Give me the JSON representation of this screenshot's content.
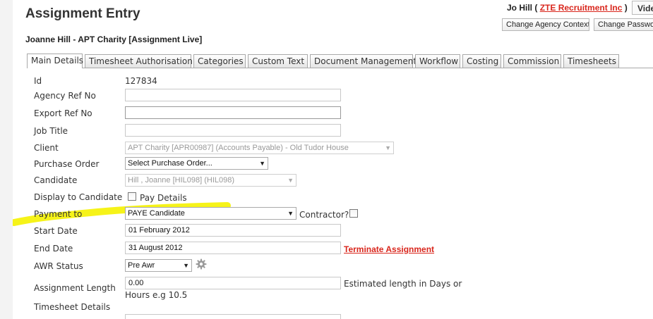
{
  "header": {
    "title": "Assignment Entry",
    "subtitle": "Joanne Hill - APT Charity [Assignment Live]",
    "user_name": "Jo Hill",
    "user_prefix": "(",
    "company_link": "ZTE Recruitment Inc",
    "user_suffix": ")",
    "video_button": "Video",
    "change_agency_button": "Change Agency Context",
    "change_password_button": "Change Password"
  },
  "tabs": [
    {
      "label": "Main Details",
      "active": true
    },
    {
      "label": "Timesheet Authorisation"
    },
    {
      "label": "Categories"
    },
    {
      "label": "Custom Text"
    },
    {
      "label": "Document Management"
    },
    {
      "label": "Workflow"
    },
    {
      "label": "Costing"
    },
    {
      "label": "Commission"
    },
    {
      "label": "Timesheets"
    }
  ],
  "form": {
    "id_label": "Id",
    "id_value": "127834",
    "agency_ref_label": "Agency Ref No",
    "agency_ref_value": "",
    "export_ref_label": "Export Ref No",
    "export_ref_value": "",
    "job_title_label": "Job Title",
    "job_title_value": "",
    "client_label": "Client",
    "client_value": "APT Charity [APR00987] (Accounts Payable) - Old Tudor House",
    "purchase_order_label": "Purchase Order",
    "purchase_order_value": "Select Purchase Order...",
    "candidate_label": "Candidate",
    "candidate_value": "Hill , Joanne [HIL098] (HIL098)",
    "display_to_candidate_label": "Display to Candidate",
    "pay_details_label": "Pay Details",
    "payment_to_label": "Payment to",
    "payment_to_value": "PAYE Candidate",
    "contractor_label": "Contractor?",
    "start_date_label": "Start Date",
    "start_date_value": "01 February 2012",
    "end_date_label": "End Date",
    "end_date_value": "31 August 2012",
    "terminate_link": "Terminate Assignment",
    "awr_status_label": "AWR Status",
    "awr_status_value": "Pre Awr",
    "assignment_length_label": "Assignment Length",
    "assignment_length_value": "0.00",
    "assignment_length_hint_1": "Estimated length in Days or",
    "assignment_length_hint_2": "Hours e.g 10.5",
    "timesheet_details_label": "Timesheet Details"
  },
  "colors": {
    "link": "#d9261c",
    "highlight": "#f5f200"
  },
  "icons": {
    "dropdown": "chevron-down-icon",
    "settings": "gear-icon"
  }
}
